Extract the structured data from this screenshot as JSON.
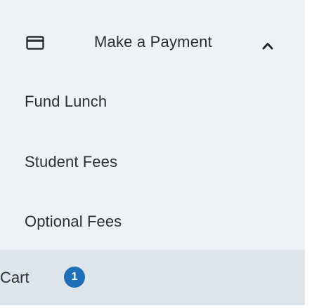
{
  "menu": {
    "header": {
      "icon": "credit-card-icon",
      "label": "Make a Payment",
      "chevron": "chevron-up-icon",
      "expanded": true
    },
    "items": [
      {
        "label": "Fund Lunch"
      },
      {
        "label": "Student Fees"
      },
      {
        "label": "Optional Fees"
      }
    ],
    "cart": {
      "label": "Cart",
      "count": "1"
    }
  },
  "colors": {
    "background": "#eef2f6",
    "cart_background": "#dfe5ec",
    "text": "#2b2f33",
    "badge": "#1f6fb8"
  }
}
